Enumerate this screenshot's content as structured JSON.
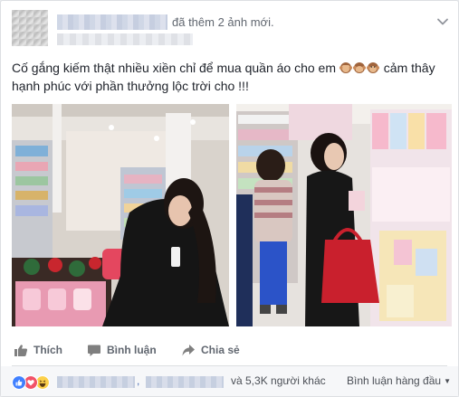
{
  "post": {
    "action_text": "đã thêm 2 ảnh mới.",
    "caption_part1": "Cố gắng kiếm thật nhiều xiền chỉ để mua quần áo cho em",
    "caption_part2": "cảm thây hạnh phúc với phần thưởng lộc trời cho !!!",
    "caption_emojis": [
      "monkey-emoji",
      "monkey-emoji",
      "monkey-emoji"
    ]
  },
  "actions": {
    "like_label": "Thích",
    "comment_label": "Bình luận",
    "share_label": "Chia sẻ"
  },
  "reactions": {
    "icons": [
      "like-reaction-icon",
      "love-reaction-icon",
      "haha-reaction-icon"
    ],
    "separator": ",",
    "others_text": "và 5,3K người khác",
    "sort_label": "Bình luận hàng đầu"
  },
  "colors": {
    "link_blue": "#4267b2",
    "secondary_text": "#616770",
    "like_blue": "#4080ff",
    "love_red": "#f25268",
    "haha_yellow": "#fcd04a"
  }
}
